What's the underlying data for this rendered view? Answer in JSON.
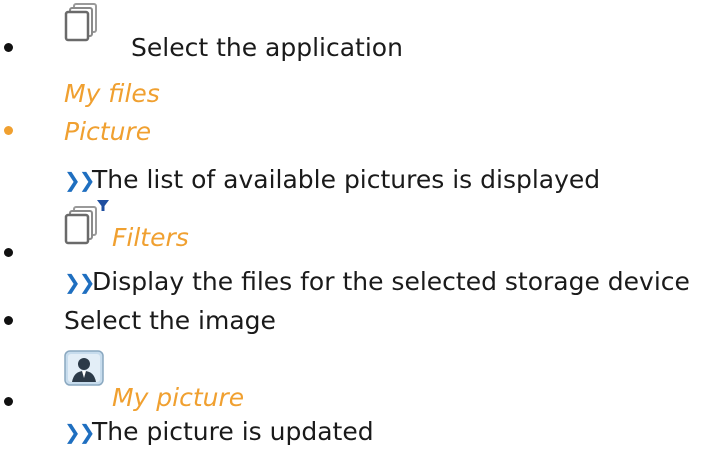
{
  "steps": [
    {
      "label": "Select the application",
      "sublabel": "My files"
    },
    {
      "label": "Picture",
      "result": "The list of available pictures is displayed"
    },
    {
      "label": "Filters",
      "result": "Display the files for the selected storage device"
    },
    {
      "label": "Select the image"
    },
    {
      "label": "My picture",
      "result": "The picture is updated"
    }
  ],
  "arrow_glyph": "❯❯",
  "colors": {
    "highlight": "#f0a030",
    "arrow": "#1f6fc0",
    "text": "#1a1a1a"
  },
  "icons": [
    "stacked-pages-icon",
    "filter-pages-icon",
    "user-picture-icon"
  ]
}
